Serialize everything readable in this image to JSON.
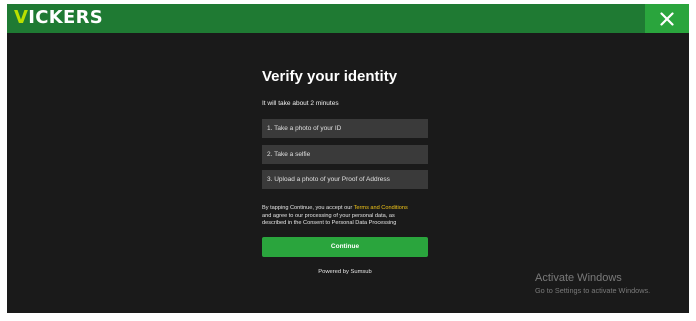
{
  "header": {
    "logo_first_letter": "V",
    "logo_rest": "ICKERS",
    "close_icon": "close-icon",
    "colors": {
      "bar": "#1f7a33",
      "accent": "#2aa53d",
      "logo_v": "#b9e000"
    }
  },
  "verify": {
    "title": "Verify your identity",
    "subtitle": "It will take about 2 minutes",
    "steps": [
      "1. Take a photo of your ID",
      "2. Take a selfie",
      "3. Upload a photo of your Proof of Address"
    ],
    "consent": {
      "line1_prefix": "By tapping Continue, you accept our ",
      "terms_link": "Terms and Conditions",
      "line2": "and agree to our processing of your personal data, as",
      "line3": "described in the Consent to Personal Data Processing"
    },
    "continue_label": "Continue",
    "powered_by": "Powered by Sumsub"
  },
  "windows_watermark": {
    "title": "Activate Windows",
    "subtitle": "Go to Settings to activate Windows."
  }
}
